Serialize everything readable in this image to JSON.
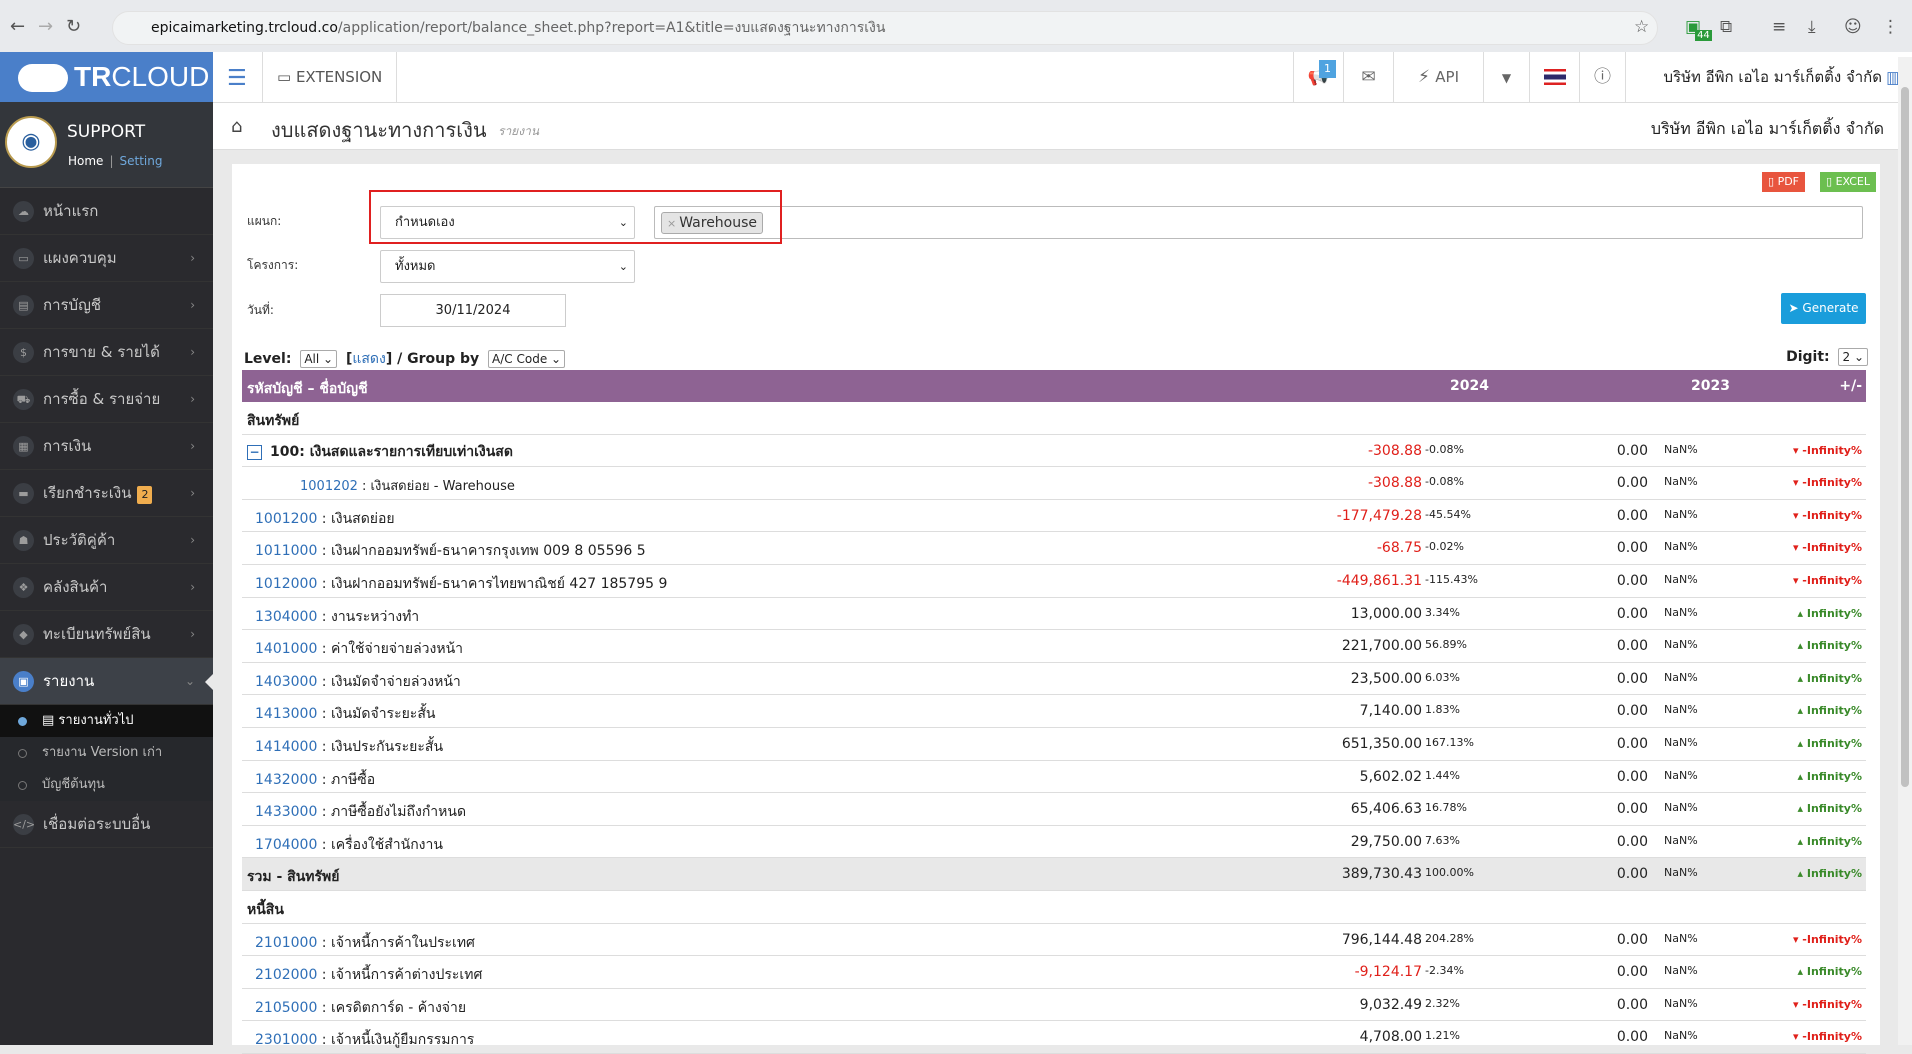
{
  "browser": {
    "url_host": "epicaimarketing.trcloud.co",
    "url_path": "/application/report/balance_sheet.php?report=A1&title=งบแสดงฐานะทางการเงิน",
    "ext_badge": "44"
  },
  "sidebar": {
    "logo_bold": "TR",
    "logo_light": "CLOUD",
    "profile_name": "SUPPORT",
    "home_link": "Home",
    "setting_link": "Setting",
    "items": [
      {
        "label": "หน้าแรก",
        "icon": "cloud-icon"
      },
      {
        "label": "แผงควบคุม",
        "icon": "monitor-icon"
      },
      {
        "label": "การบัญชี",
        "icon": "book-icon"
      },
      {
        "label": "การขาย & รายได้",
        "icon": "dollar-icon"
      },
      {
        "label": "การซื้อ & รายจ่าย",
        "icon": "cart-icon"
      },
      {
        "label": "การเงิน",
        "icon": "calendar-icon"
      },
      {
        "label": "เรียกชำระเงิน",
        "icon": "card-icon",
        "badge": "2"
      },
      {
        "label": "ประวัติคู่ค้า",
        "icon": "address-book-icon"
      },
      {
        "label": "คลังสินค้า",
        "icon": "cubes-icon"
      },
      {
        "label": "ทะเบียนทรัพย์สิน",
        "icon": "diamond-icon"
      },
      {
        "label": "รายงาน",
        "icon": "report-icon"
      }
    ],
    "sub_items": [
      "รายงานทั่วไป",
      "รายงาน Version เก่า",
      "บัญชีต้นทุน"
    ],
    "connect": "เชื่อมต่อระบบอื่น"
  },
  "topbar": {
    "extension": "EXTENSION",
    "notif_count": "1",
    "api": "API",
    "company": "บริษัท อีพิก เอไอ มาร์เก็ตติ้ง จำกัด"
  },
  "page": {
    "title": "งบแสดงฐานะทางการเงิน",
    "subtitle": "รายงาน",
    "company": "บริษัท อีพิก เอไอ มาร์เก็ตติ้ง จำกัด"
  },
  "filters": {
    "pdf": "PDF",
    "excel": "EXCEL",
    "dept_label": "แผนก:",
    "dept_value": "กำหนดเอง",
    "dept_tag": "Warehouse",
    "project_label": "โครงการ:",
    "project_value": "ทั้งหมด",
    "date_label": "วันที่:",
    "date_value": "30/11/2024",
    "generate": "Generate",
    "level_label": "Level:",
    "level_value": "All",
    "show_link": "แสดง",
    "group_label": "Group by",
    "group_value": "A/C Code",
    "digit_label": "Digit:",
    "digit_value": "2"
  },
  "table": {
    "headers": {
      "account": "รหัสบัญชี – ชื่อบัญชี",
      "y2024": "2024",
      "y2023": "2023",
      "change": "+/-"
    },
    "rows": [
      {
        "type": "section",
        "name": "สินทรัพย์"
      },
      {
        "type": "group",
        "code": "100",
        "name": ": เงินสดและรายการเทียบเท่าเงินสด",
        "v24": "-308.88",
        "p24": "-0.08%",
        "v23": "0.00",
        "p23": "NaN%",
        "chg": "▾ -Infinity%",
        "neg": true,
        "up": false
      },
      {
        "type": "sub",
        "code": "1001202",
        "name": " : เงินสดย่อย - Warehouse",
        "v24": "-308.88",
        "p24": "-0.08%",
        "v23": "0.00",
        "p23": "NaN%",
        "chg": "▾ -Infinity%",
        "neg": true,
        "up": false
      },
      {
        "type": "acct",
        "code": "1001200",
        "name": " : เงินสดย่อย",
        "v24": "-177,479.28",
        "p24": "-45.54%",
        "v23": "0.00",
        "p23": "NaN%",
        "chg": "▾ -Infinity%",
        "neg": true,
        "up": false
      },
      {
        "type": "acct",
        "code": "1011000",
        "name": " : เงินฝากออมทรัพย์-ธนาคารกรุงเทพ 009 8 05596 5",
        "v24": "-68.75",
        "p24": "-0.02%",
        "v23": "0.00",
        "p23": "NaN%",
        "chg": "▾ -Infinity%",
        "neg": true,
        "up": false
      },
      {
        "type": "acct",
        "code": "1012000",
        "name": " : เงินฝากออมทรัพย์-ธนาคารไทยพาณิชย์ 427 185795 9",
        "v24": "-449,861.31",
        "p24": "-115.43%",
        "v23": "0.00",
        "p23": "NaN%",
        "chg": "▾ -Infinity%",
        "neg": true,
        "up": false
      },
      {
        "type": "acct",
        "code": "1304000",
        "name": " : งานระหว่างทำ",
        "v24": "13,000.00",
        "p24": "3.34%",
        "v23": "0.00",
        "p23": "NaN%",
        "chg": "▴ Infinity%",
        "neg": false,
        "up": true
      },
      {
        "type": "acct",
        "code": "1401000",
        "name": " : ค่าใช้จ่ายจ่ายล่วงหน้า",
        "v24": "221,700.00",
        "p24": "56.89%",
        "v23": "0.00",
        "p23": "NaN%",
        "chg": "▴ Infinity%",
        "neg": false,
        "up": true
      },
      {
        "type": "acct",
        "code": "1403000",
        "name": " : เงินมัดจำจ่ายล่วงหน้า",
        "v24": "23,500.00",
        "p24": "6.03%",
        "v23": "0.00",
        "p23": "NaN%",
        "chg": "▴ Infinity%",
        "neg": false,
        "up": true
      },
      {
        "type": "acct",
        "code": "1413000",
        "name": " : เงินมัดจำระยะสั้น",
        "v24": "7,140.00",
        "p24": "1.83%",
        "v23": "0.00",
        "p23": "NaN%",
        "chg": "▴ Infinity%",
        "neg": false,
        "up": true
      },
      {
        "type": "acct",
        "code": "1414000",
        "name": " : เงินประกันระยะสั้น",
        "v24": "651,350.00",
        "p24": "167.13%",
        "v23": "0.00",
        "p23": "NaN%",
        "chg": "▴ Infinity%",
        "neg": false,
        "up": true
      },
      {
        "type": "acct",
        "code": "1432000",
        "name": " : ภาษีซื้อ",
        "v24": "5,602.02",
        "p24": "1.44%",
        "v23": "0.00",
        "p23": "NaN%",
        "chg": "▴ Infinity%",
        "neg": false,
        "up": true
      },
      {
        "type": "acct",
        "code": "1433000",
        "name": " : ภาษีซื้อยังไม่ถึงกำหนด",
        "v24": "65,406.63",
        "p24": "16.78%",
        "v23": "0.00",
        "p23": "NaN%",
        "chg": "▴ Infinity%",
        "neg": false,
        "up": true
      },
      {
        "type": "acct",
        "code": "1704000",
        "name": " : เครื่องใช้สำนักงาน",
        "v24": "29,750.00",
        "p24": "7.63%",
        "v23": "0.00",
        "p23": "NaN%",
        "chg": "▴ Infinity%",
        "neg": false,
        "up": true
      },
      {
        "type": "total",
        "name": "รวม - สินทรัพย์",
        "v24": "389,730.43",
        "p24": "100.00%",
        "v23": "0.00",
        "p23": "NaN%",
        "chg": "▴ Infinity%",
        "neg": false,
        "up": true
      },
      {
        "type": "section",
        "name": "หนี้สิน"
      },
      {
        "type": "acct",
        "code": "2101000",
        "name": " : เจ้าหนี้การค้าในประเทศ",
        "v24": "796,144.48",
        "p24": "204.28%",
        "v23": "0.00",
        "p23": "NaN%",
        "chg": "▾ -Infinity%",
        "neg": false,
        "up": false
      },
      {
        "type": "acct",
        "code": "2102000",
        "name": " : เจ้าหนี้การค้าต่างประเทศ",
        "v24": "-9,124.17",
        "p24": "-2.34%",
        "v23": "0.00",
        "p23": "NaN%",
        "chg": "▴ Infinity%",
        "neg": true,
        "up": true
      },
      {
        "type": "acct",
        "code": "2105000",
        "name": " : เครดิตการ์ด - ค้างจ่าย",
        "v24": "9,032.49",
        "p24": "2.32%",
        "v23": "0.00",
        "p23": "NaN%",
        "chg": "▾ -Infinity%",
        "neg": false,
        "up": false
      },
      {
        "type": "acct",
        "code": "2301000",
        "name": " : เจ้าหนี้เงินกู้ยืมกรรมการ",
        "v24": "4,708.00",
        "p24": "1.21%",
        "v23": "0.00",
        "p23": "NaN%",
        "chg": "▾ -Infinity%",
        "neg": false,
        "up": false
      }
    ]
  }
}
